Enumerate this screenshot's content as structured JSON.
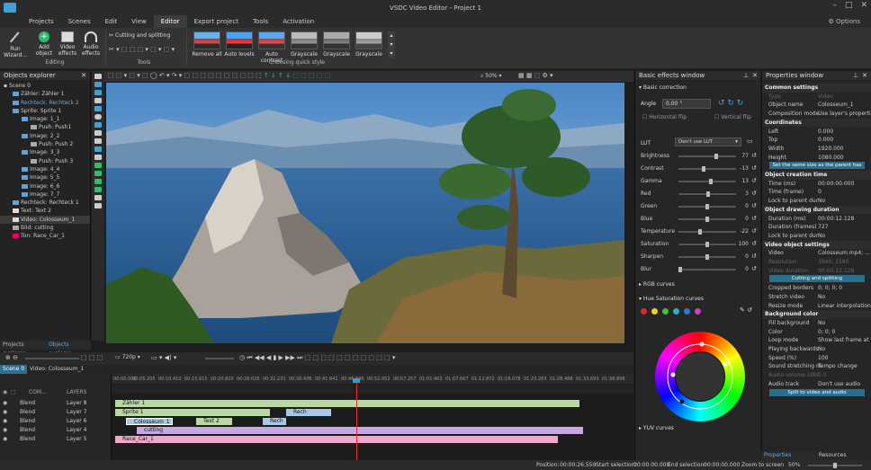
{
  "window": {
    "title": "VSDC Video Editor - Project 1"
  },
  "menu": {
    "tabs": [
      "Projects",
      "Scenes",
      "Edit",
      "View",
      "Editor",
      "Export project",
      "Tools",
      "Activation"
    ],
    "active": "Editor",
    "options": "Options"
  },
  "ribbon": {
    "run_wizard": "Run Wizard...",
    "add_object": "Add object",
    "video_effects": "Video effects",
    "audio_effects": "Audio effects",
    "editing_group": "Editing",
    "cutting": "Cutting and splitting",
    "tools_group": "Tools",
    "quick_styles": [
      "Remove all",
      "Auto levels",
      "Auto contrast",
      "Grayscale",
      "Grayscale",
      "Grayscale"
    ],
    "quick_group": "Choosing quick style"
  },
  "objects_explorer": {
    "title": "Objects explorer",
    "items": [
      "Scene 0",
      "Zähler: Zähler 1",
      "Rechteck: Rechteck 2",
      "Sprite: Sprite 1",
      "Image: 1_1",
      "Push: Push1",
      "Image: 2_2",
      "Push: Push 2",
      "Image: 3_3",
      "Push: Push 3",
      "Image: 4_4",
      "Image: 5_5",
      "Image: 6_6",
      "Image: 7_7",
      "Rechteck: Rechteck 1",
      "Text: Text 2",
      "Video: Colosseum_1",
      "Bild: cutting",
      "Ton: Race_Car_1"
    ],
    "tabs": [
      "Projects explorer",
      "Objects explorer"
    ]
  },
  "preview": {
    "zoom": "50%"
  },
  "playback": {
    "quality": "720p"
  },
  "scene_tabs": [
    "Scene 0",
    "Video: Colosseum_1"
  ],
  "timeline": {
    "header": "LAYERS",
    "header_prefix": "COM...",
    "layers": [
      {
        "blend": "Blend",
        "name": "Layer 8"
      },
      {
        "blend": "Blend",
        "name": "Layer 7"
      },
      {
        "blend": "Blend",
        "name": "Layer 6"
      },
      {
        "blend": "Blend",
        "name": "Layer 4"
      },
      {
        "blend": "Blend",
        "name": "Layer 5"
      }
    ],
    "ruler": [
      "00:00.000",
      "00:05.205",
      "00:10.410",
      "00:15.615",
      "00:20.820",
      "00:26.026",
      "00:31.231",
      "00:36.436",
      "00:41.641",
      "00:46.846",
      "00:52.052",
      "00:57.257",
      "01:02.462",
      "01:07.667",
      "01:12.872",
      "01:18.078",
      "01:23.283",
      "01:28.488",
      "01:33.693",
      "01:38.898"
    ],
    "clips": {
      "zahler": "Zähler 1",
      "sprite": "Sprite 1",
      "rech1": "Rech",
      "colosseum": "Colosseum_1",
      "text2": "Text 2",
      "rech2": "Rech",
      "cutting": "cutting",
      "racecar": "Race_Car_1"
    }
  },
  "status": {
    "position_label": "Position:",
    "position": "00:00:26.559",
    "start_label": "Start selection:",
    "start": "00:00:00.000",
    "end_label": "End selection:",
    "end": "00:00:00.000",
    "zoom_label": "Zoom to screen",
    "zoom": "50%"
  },
  "basic_effects": {
    "title": "Basic effects window",
    "basic_correction": "Basic correction",
    "angle_label": "Angle",
    "angle": "0.00 °",
    "hflip": "Horizontal flip",
    "vflip": "Vertical flip",
    "lut_label": "LUT",
    "lut": "Don't use LUT",
    "sliders": [
      {
        "name": "Brightness",
        "value": "77"
      },
      {
        "name": "Contrast",
        "value": "-13"
      },
      {
        "name": "Gamma",
        "value": "13"
      },
      {
        "name": "Red",
        "value": "3"
      },
      {
        "name": "Green",
        "value": "0"
      },
      {
        "name": "Blue",
        "value": "0"
      },
      {
        "name": "Temperature",
        "value": "-22"
      },
      {
        "name": "Saturation",
        "value": "100"
      },
      {
        "name": "Sharpen",
        "value": "0"
      },
      {
        "name": "Blur",
        "value": "0"
      }
    ],
    "rgb_curves": "RGB curves",
    "hue_sat": "Hue Saturation curves",
    "yuv": "YUV curves",
    "swatches": [
      "#e0262b",
      "#f2cf1d",
      "#3fbf3f",
      "#1fb8c8",
      "#3a6fd8",
      "#c43fd0"
    ]
  },
  "properties": {
    "title": "Properties window",
    "rows": [
      {
        "t": "sec",
        "k": "Common settings"
      },
      {
        "t": "dis",
        "k": "Type",
        "v": "Video"
      },
      {
        "k": "Object name",
        "v": "Colosseum_1"
      },
      {
        "k": "Composition mode",
        "v": "Use layer's properties"
      },
      {
        "t": "sec",
        "k": "Coordinates"
      },
      {
        "k": "Left",
        "v": "0.000"
      },
      {
        "k": "Top",
        "v": "0.000"
      },
      {
        "k": "Width",
        "v": "1920.000"
      },
      {
        "k": "Height",
        "v": "1080.000"
      },
      {
        "t": "btn",
        "k": "Set the same size as the parent has"
      },
      {
        "t": "sec",
        "k": "Object creation time"
      },
      {
        "k": "Time (ms)",
        "v": "00:00:00.000"
      },
      {
        "k": "Time (frame)",
        "v": "0"
      },
      {
        "k": "Lock to parent dur",
        "v": "No"
      },
      {
        "t": "sec",
        "k": "Object drawing duration"
      },
      {
        "k": "Duration (ms)",
        "v": "00:00:12.128"
      },
      {
        "k": "Duration (frames)",
        "v": "727"
      },
      {
        "k": "Lock to parent dur",
        "v": "No"
      },
      {
        "t": "sec",
        "k": "Video object settings"
      },
      {
        "k": "Video",
        "v": "Colosseum.mp4; ..."
      },
      {
        "t": "dis",
        "k": "Resolution",
        "v": "3840; 2160"
      },
      {
        "t": "dis",
        "k": "Video duration",
        "v": "00:00:12.128"
      },
      {
        "t": "btn",
        "k": "Cutting and splitting"
      },
      {
        "k": "Cropped borders",
        "v": "0; 0; 0; 0"
      },
      {
        "k": "Stretch video",
        "v": "No"
      },
      {
        "k": "Resize mode",
        "v": "Linear interpolation"
      },
      {
        "t": "sec",
        "k": "Background color"
      },
      {
        "k": "Fill background",
        "v": "No"
      },
      {
        "k": "Color",
        "v": "0; 0; 0"
      },
      {
        "k": "Loop mode",
        "v": "Show last frame at the e..."
      },
      {
        "k": "Playing backwards",
        "v": "No"
      },
      {
        "k": "Speed (%)",
        "v": "100"
      },
      {
        "k": "Sound stretching m",
        "v": "Tempo change"
      },
      {
        "t": "dis",
        "k": "Audio volume (dB)",
        "v": "0.0"
      },
      {
        "k": "Audio track",
        "v": "Don't use audio"
      },
      {
        "t": "btn",
        "k": "Split to video and audio"
      }
    ],
    "tabs": [
      "Properties window",
      "Resources window"
    ]
  },
  "colors": {
    "accent": "#2a6e8d",
    "clip_green": "#b9d9a0",
    "clip_blue": "#a8c8e8",
    "clip_purple": "#c8a8e0",
    "clip_pink": "#f0a8c8"
  }
}
